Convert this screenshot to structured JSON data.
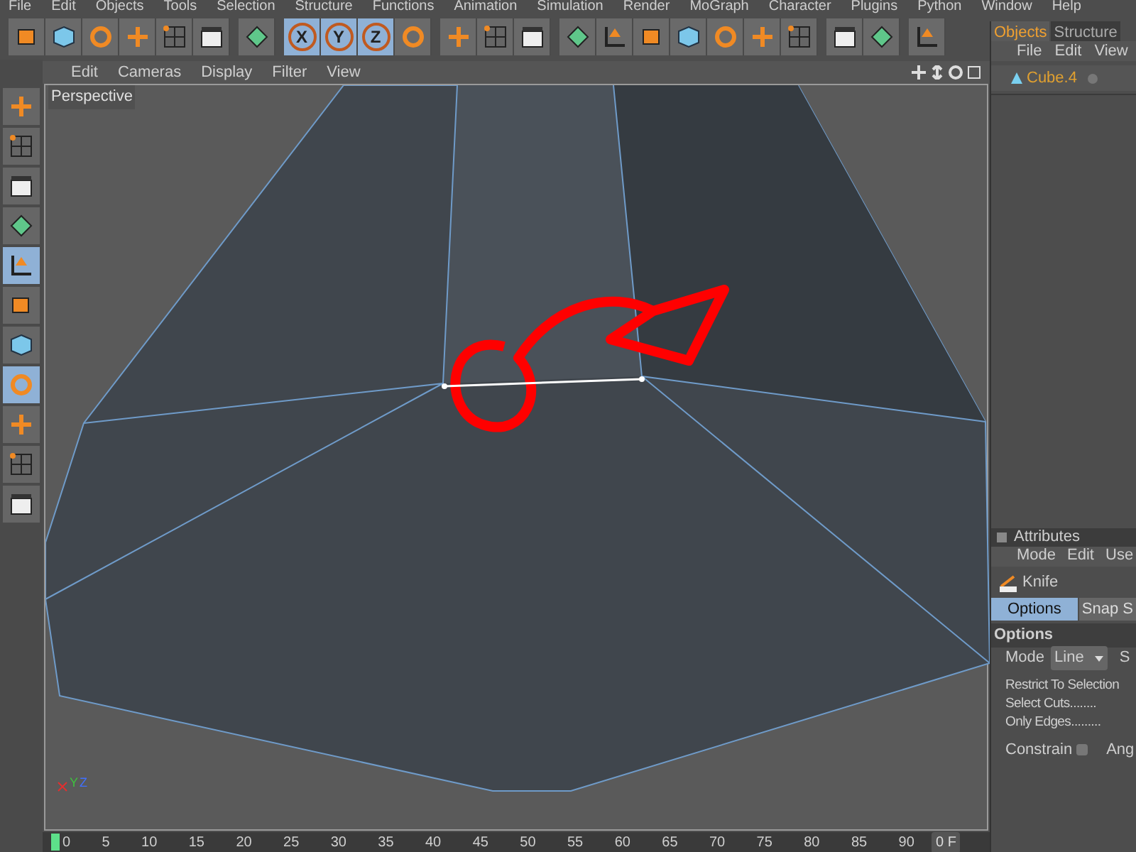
{
  "menu_bar": [
    "File",
    "Edit",
    "Objects",
    "Tools",
    "Selection",
    "Structure",
    "Functions",
    "Animation",
    "Simulation",
    "Render",
    "MoGraph",
    "Character",
    "Plugins",
    "Python",
    "Window",
    "Help"
  ],
  "toolbar": {
    "groups": [
      [
        {
          "selected": false
        },
        {
          "selected": false
        },
        {
          "selected": false
        },
        {
          "selected": false
        },
        {
          "selected": false
        },
        {
          "selected": false
        }
      ],
      [
        {
          "selected": false
        }
      ],
      [
        {
          "label": "X",
          "selected": true
        },
        {
          "label": "Y",
          "selected": true
        },
        {
          "label": "Z",
          "selected": true
        },
        {
          "selected": false
        }
      ],
      [
        {
          "selected": false
        },
        {
          "selected": false
        },
        {
          "selected": false
        }
      ],
      [
        {
          "selected": false
        },
        {
          "selected": false
        },
        {
          "selected": false
        },
        {
          "selected": false
        },
        {
          "selected": false
        },
        {
          "selected": false
        },
        {
          "selected": false
        }
      ],
      [
        {
          "selected": false
        },
        {
          "selected": false
        }
      ],
      [
        {
          "selected": false
        }
      ]
    ]
  },
  "left_toolbar": [
    {
      "selected": false
    },
    {
      "selected": false
    },
    {
      "selected": false
    },
    {
      "selected": false
    },
    {
      "selected": true
    },
    {
      "selected": false
    },
    {
      "selected": false
    },
    {
      "selected": true
    },
    {
      "selected": false
    },
    {
      "selected": false
    },
    {
      "selected": false
    }
  ],
  "viewport": {
    "menu": [
      "Edit",
      "Cameras",
      "Display",
      "Filter",
      "View"
    ],
    "label": "Perspective",
    "axis_labels": [
      "Y",
      "Z"
    ]
  },
  "timeline": {
    "ticks": [
      "0",
      "5",
      "10",
      "15",
      "20",
      "25",
      "30",
      "35",
      "40",
      "45",
      "50",
      "55",
      "60",
      "65",
      "70",
      "75",
      "80",
      "85",
      "90"
    ],
    "current_frame": "0 F"
  },
  "objects_panel": {
    "tabs": [
      {
        "label": "Objects",
        "selected": true
      },
      {
        "label": "Structure",
        "selected": false
      }
    ],
    "menu": [
      "File",
      "Edit",
      "View"
    ],
    "objects": [
      {
        "name": "Cube.4"
      }
    ]
  },
  "attributes_panel": {
    "title": "Attributes",
    "menu": [
      "Mode",
      "Edit",
      "Use"
    ],
    "tool": "Knife",
    "tabs": [
      {
        "label": "Options",
        "selected": true
      },
      {
        "label": "Snap S",
        "selected": false
      }
    ],
    "section": "Options",
    "mode": {
      "label": "Mode",
      "value": "Line",
      "next_label": "S"
    },
    "options": [
      {
        "label": "Restrict To Selection"
      },
      {
        "label": "Select Cuts",
        "leader": "........"
      },
      {
        "label": "Only Edges",
        "leader": "........."
      }
    ],
    "constrain": {
      "label": "Constrain",
      "checked": false,
      "next_label": "Ang"
    }
  }
}
